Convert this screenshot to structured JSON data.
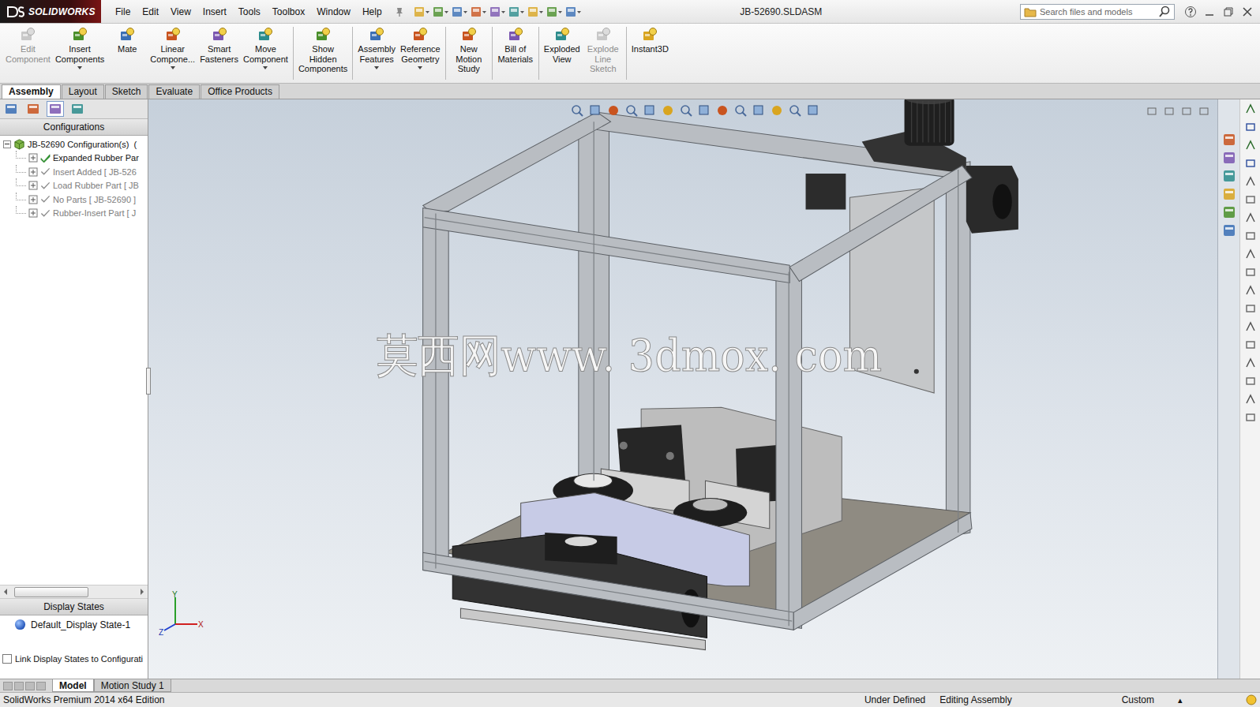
{
  "app": {
    "logo": "SOLIDWORKS"
  },
  "menu": [
    "File",
    "Edit",
    "View",
    "Insert",
    "Tools",
    "Toolbox",
    "Window",
    "Help"
  ],
  "window": {
    "title": "JB-52690.SLDASM"
  },
  "search": {
    "placeholder": "Search files and models"
  },
  "ribbon": [
    [
      {
        "lines": [
          "Edit",
          "Component"
        ],
        "disabled": true,
        "dropdown": false
      },
      {
        "lines": [
          "Insert",
          "Components"
        ],
        "disabled": false,
        "dropdown": true
      },
      {
        "lines": [
          "Mate"
        ],
        "disabled": false,
        "dropdown": false
      },
      {
        "lines": [
          "Linear",
          "Compone..."
        ],
        "disabled": false,
        "dropdown": true
      },
      {
        "lines": [
          "Smart",
          "Fasteners"
        ],
        "disabled": false,
        "dropdown": false
      },
      {
        "lines": [
          "Move",
          "Component"
        ],
        "disabled": false,
        "dropdown": true
      }
    ],
    [
      {
        "lines": [
          "Show",
          "Hidden",
          "Components"
        ],
        "disabled": false,
        "dropdown": false
      }
    ],
    [
      {
        "lines": [
          "Assembly",
          "Features"
        ],
        "disabled": false,
        "dropdown": true
      },
      {
        "lines": [
          "Reference",
          "Geometry"
        ],
        "disabled": false,
        "dropdown": true
      }
    ],
    [
      {
        "lines": [
          "New",
          "Motion",
          "Study"
        ],
        "disabled": false,
        "dropdown": false
      }
    ],
    [
      {
        "lines": [
          "Bill of",
          "Materials"
        ],
        "disabled": false,
        "dropdown": false
      }
    ],
    [
      {
        "lines": [
          "Exploded",
          "View"
        ],
        "disabled": false,
        "dropdown": false
      },
      {
        "lines": [
          "Explode",
          "Line",
          "Sketch"
        ],
        "disabled": true,
        "dropdown": false
      }
    ],
    [
      {
        "lines": [
          "Instant3D"
        ],
        "disabled": false,
        "dropdown": false
      }
    ]
  ],
  "tabs": [
    {
      "label": "Assembly",
      "selected": true
    },
    {
      "label": "Layout",
      "selected": false
    },
    {
      "label": "Sketch",
      "selected": false
    },
    {
      "label": "Evaluate",
      "selected": false
    },
    {
      "label": "Office Products",
      "selected": false
    }
  ],
  "configurations": {
    "title": "Configurations",
    "root": "JB-52690 Configuration(s)  (",
    "items": [
      {
        "label": "Expanded Rubber Par",
        "active": true
      },
      {
        "label": "Insert Added [ JB-526",
        "active": false
      },
      {
        "label": "Load Rubber Part [ JB",
        "active": false
      },
      {
        "label": "No Parts [ JB-52690 ]",
        "active": false
      },
      {
        "label": "Rubber-Insert Part [ J",
        "active": false
      }
    ]
  },
  "display_states": {
    "title": "Display States",
    "items": [
      "Default_Display State-1"
    ]
  },
  "link_option": {
    "label": "Link Display States to Configurati",
    "checked": false
  },
  "viewport": {
    "watermark": "莫西网www. 3dmox. com",
    "triad": {
      "y": "Y",
      "x": "X",
      "z": "Z"
    }
  },
  "bottom_tabs": [
    {
      "label": "Model",
      "selected": true
    },
    {
      "label": "Motion Study 1",
      "selected": false
    }
  ],
  "status_bar": {
    "edition": "SolidWorks Premium 2014 x64 Edition",
    "state": "Under Defined",
    "mode": "Editing Assembly",
    "units": "Custom",
    "units_arrow": "▴"
  }
}
